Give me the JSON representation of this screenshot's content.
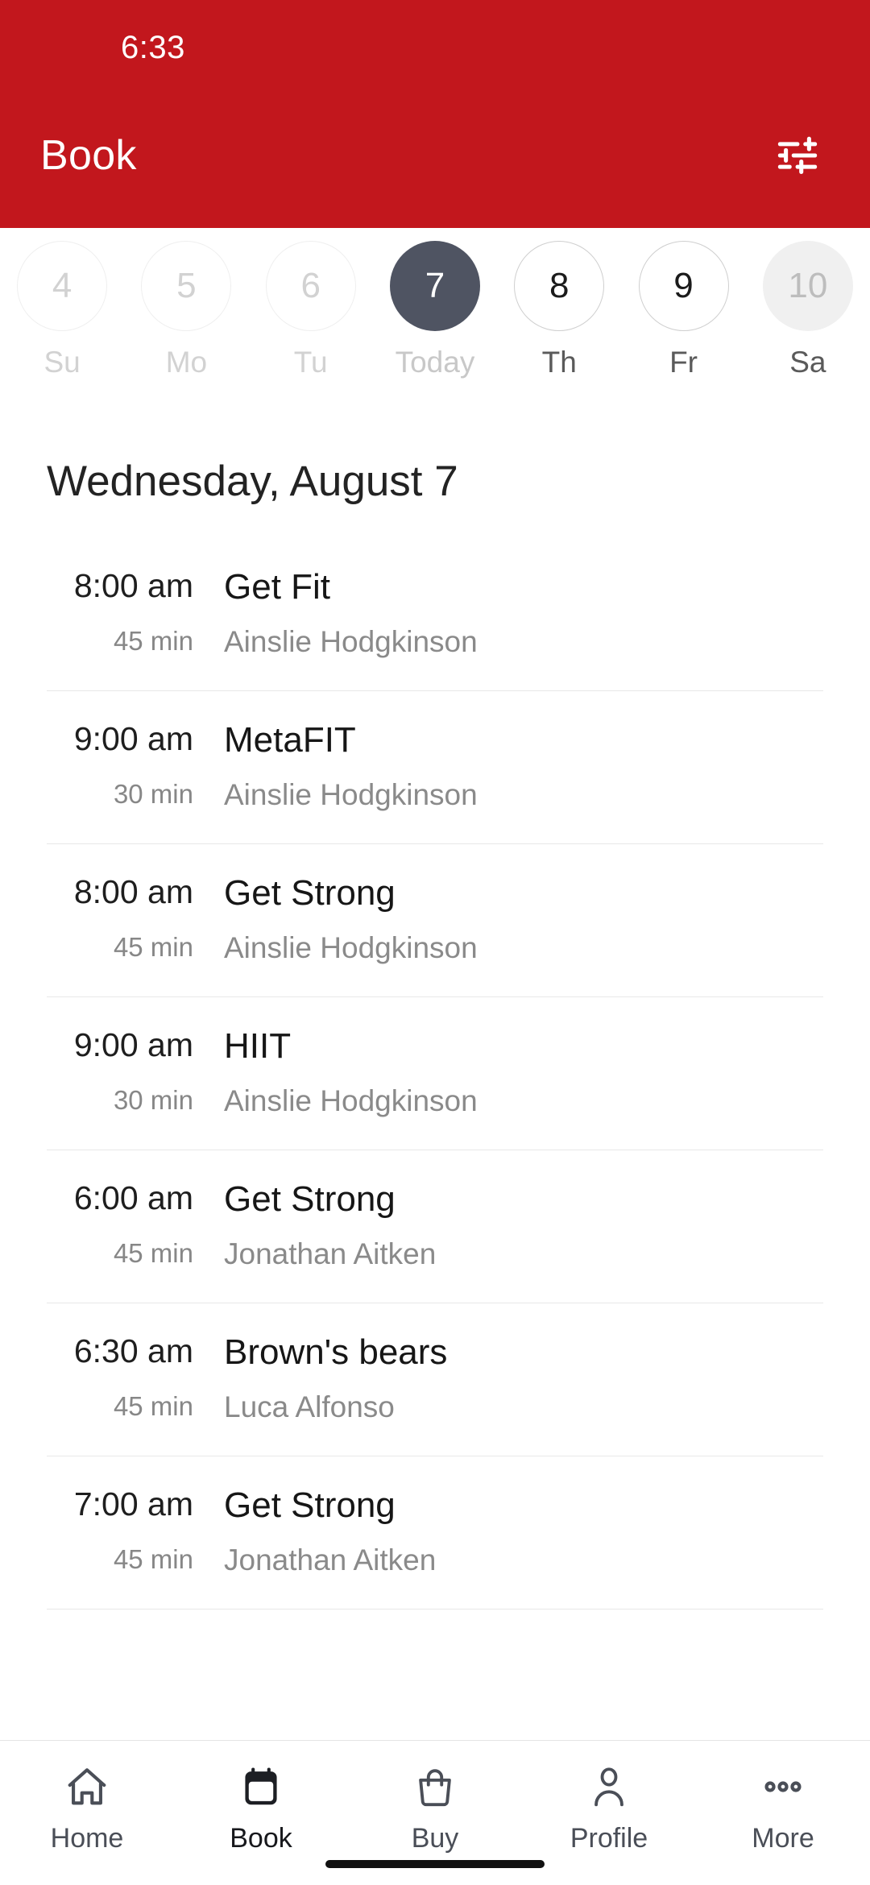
{
  "theme": {
    "brand_red": "#C2171D",
    "selected_chip": "#4F5462",
    "text_primary": "#1e1e1e",
    "text_muted": "#8a8a8a"
  },
  "status_bar": {
    "time": "6:33"
  },
  "app_bar": {
    "title": "Book",
    "filter_icon": "tune-icon"
  },
  "date_strip": {
    "days": [
      {
        "num": "4",
        "label": "Su",
        "state": "disabled"
      },
      {
        "num": "5",
        "label": "Mo",
        "state": "disabled"
      },
      {
        "num": "6",
        "label": "Tu",
        "state": "disabled"
      },
      {
        "num": "7",
        "label": "Today",
        "state": "selected"
      },
      {
        "num": "8",
        "label": "Th",
        "state": "normal"
      },
      {
        "num": "9",
        "label": "Fr",
        "state": "normal"
      },
      {
        "num": "10",
        "label": "Sa",
        "state": "filled"
      }
    ]
  },
  "day_heading": "Wednesday, August 7",
  "classes": [
    {
      "time": "8:00 am",
      "duration": "45 min",
      "name": "Get Fit",
      "instructor": "Ainslie Hodgkinson"
    },
    {
      "time": "9:00 am",
      "duration": "30 min",
      "name": "MetaFIT",
      "instructor": "Ainslie Hodgkinson"
    },
    {
      "time": "8:00 am",
      "duration": "45 min",
      "name": "Get Strong",
      "instructor": "Ainslie Hodgkinson"
    },
    {
      "time": "9:00 am",
      "duration": "30 min",
      "name": "HIIT",
      "instructor": "Ainslie Hodgkinson"
    },
    {
      "time": "6:00 am",
      "duration": "45 min",
      "name": "Get Strong",
      "instructor": "Jonathan Aitken"
    },
    {
      "time": "6:30 am",
      "duration": "45 min",
      "name": "Brown's bears",
      "instructor": "Luca Alfonso"
    },
    {
      "time": "7:00 am",
      "duration": "45 min",
      "name": "Get Strong",
      "instructor": "Jonathan Aitken"
    }
  ],
  "bottom_nav": {
    "items": [
      {
        "label": "Home",
        "icon": "home-icon",
        "active": false
      },
      {
        "label": "Book",
        "icon": "calendar-icon",
        "active": true
      },
      {
        "label": "Buy",
        "icon": "bag-icon",
        "active": false
      },
      {
        "label": "Profile",
        "icon": "person-icon",
        "active": false
      },
      {
        "label": "More",
        "icon": "ellipsis-icon",
        "active": false
      }
    ]
  }
}
